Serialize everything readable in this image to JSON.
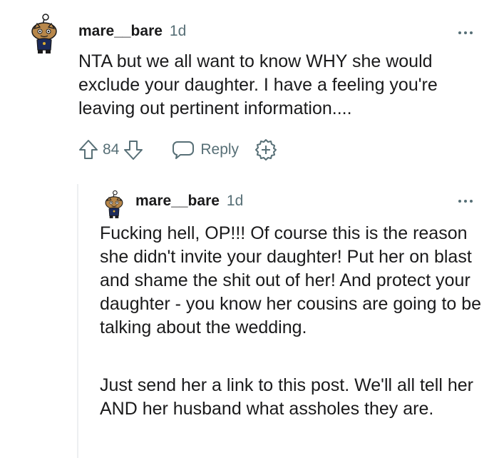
{
  "comment": {
    "username": "mare__bare",
    "timestamp": "1d",
    "body": "NTA but we all want to know WHY she would exclude your daughter. I have a feeling you're leaving out pertinent information....",
    "score": "84",
    "reply_label": "Reply",
    "avatar_icon": "snoo-avatar-icon"
  },
  "reply": {
    "username": "mare__bare",
    "timestamp": "1d",
    "paragraphs": [
      "Fucking hell, OP!!! Of course this is the reason she didn't invite your daughter! Put her on blast and shame the shit out of her! And protect your daughter - you know her cousins are going to be talking about the wedding.",
      "Just send her a link to this post. We'll all tell her AND her husband what assholes they are."
    ],
    "avatar_icon": "snoo-avatar-icon"
  },
  "colors": {
    "text": "#1a1a1b",
    "meta": "#576f76",
    "thread_line": "#edeff1"
  }
}
